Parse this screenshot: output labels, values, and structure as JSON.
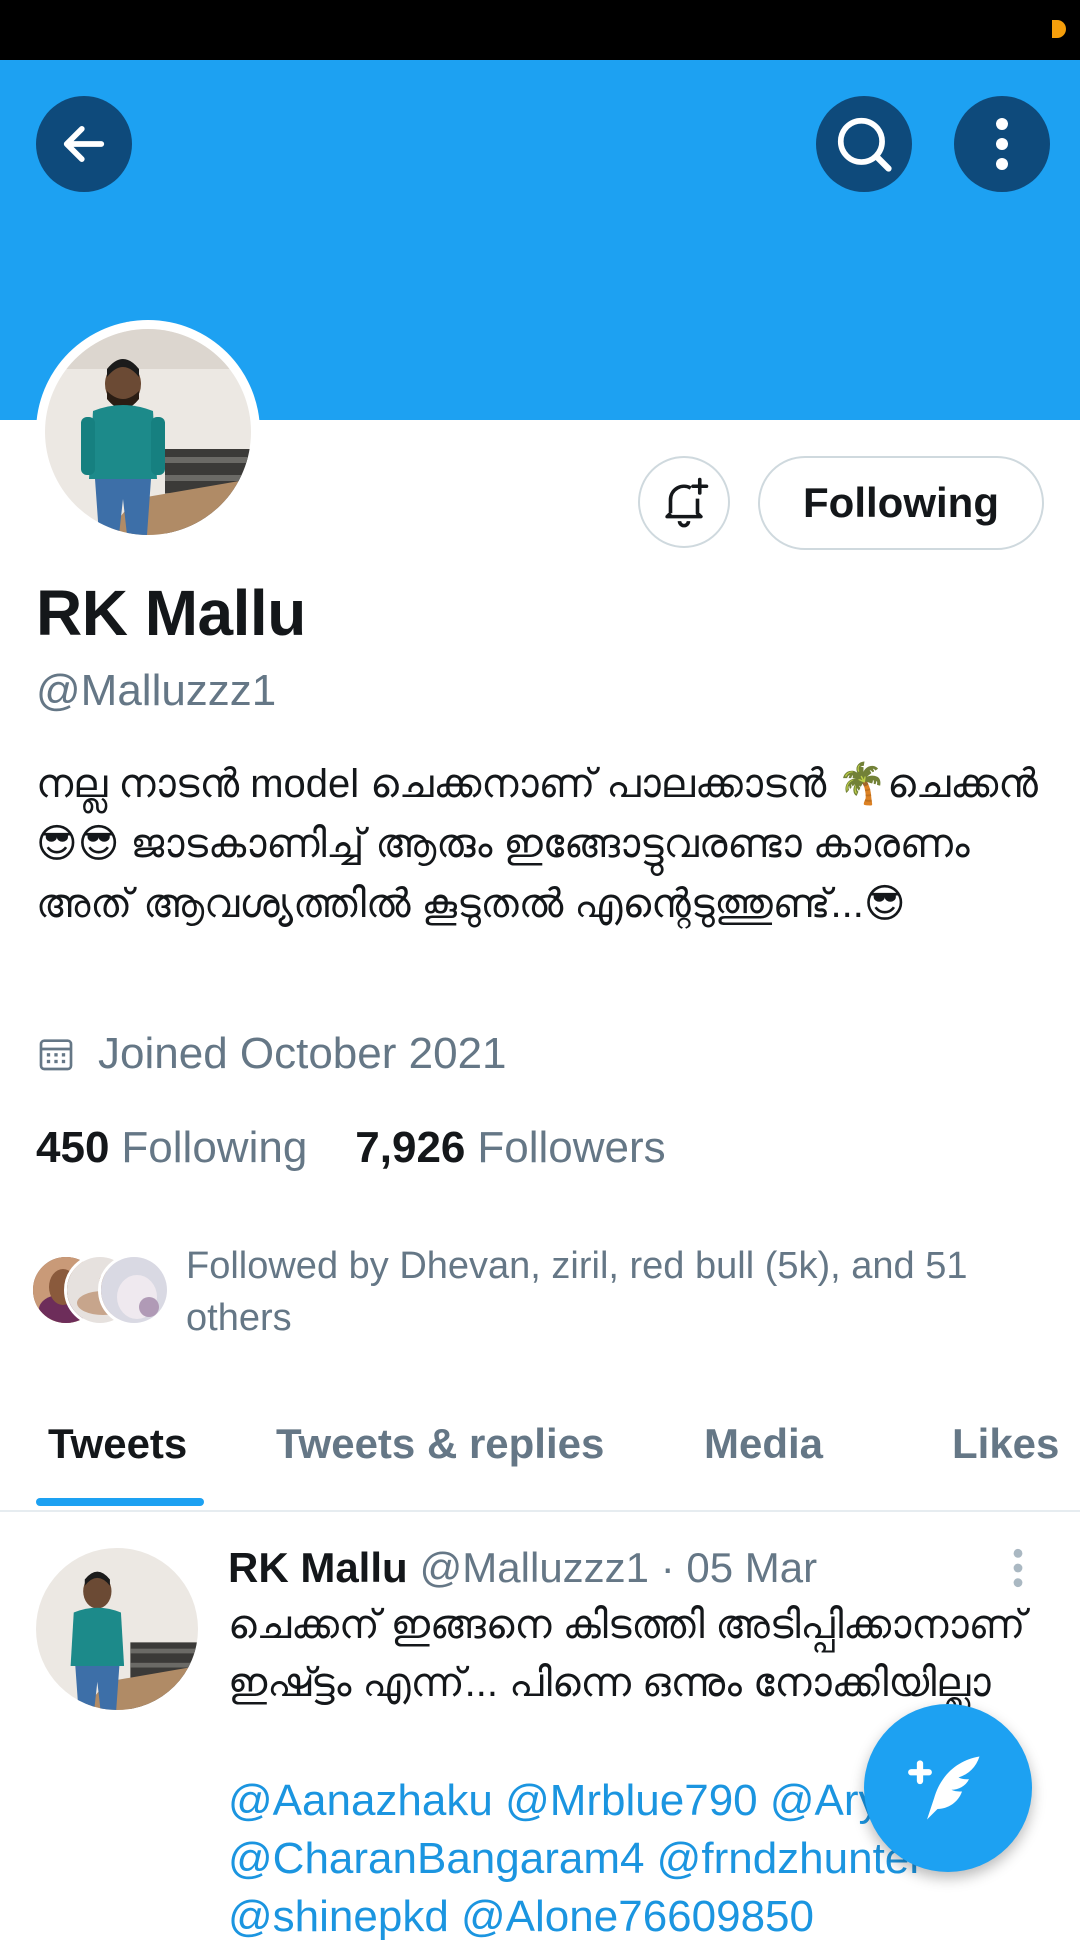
{
  "header": {
    "back_icon": "arrow-left-icon",
    "search_icon": "search-icon",
    "more_icon": "more-vertical-icon",
    "banner_color": "#1da1f2"
  },
  "profile": {
    "display_name": "RK Mallu",
    "handle": "@Malluzzz1",
    "bio": "നല്ല നാടൻ model ചെക്കനാണ് പാലക്കാടൻ 🌴ചെക്കൻ😎😎 ജാടകാണിച്ച് ആരും ഇങ്ങോട്ടുവരണ്ടാ കാരണം അത് ആവശ്യത്തിൽ കൂടുതൽ എന്റെടുത്തുണ്ട്...😎",
    "joined": "Joined October 2021",
    "following_count": "450",
    "following_label": "Following",
    "followers_count": "7,926",
    "followers_label": "Followers",
    "followed_by": "Followed by Dhevan, ziril, red bull (5k), and 51 others"
  },
  "actions": {
    "notify_icon": "bell-plus-icon",
    "follow_state": "Following"
  },
  "tabs": [
    {
      "label": "Tweets",
      "active": true
    },
    {
      "label": "Tweets & replies",
      "active": false
    },
    {
      "label": "Media",
      "active": false
    },
    {
      "label": "Likes",
      "active": false
    }
  ],
  "tweet": {
    "name": "RK Mallu",
    "meta": "@Malluzzz1 · 05 Mar",
    "text": "ചെക്കന് ഇങ്ങനെ കിടത്തി അടിപ്പിക്കാനാണ് ഇഷ്ട്ടം എന്ന്... പിന്നെ ഒന്നും നോക്കിയില്ലാ",
    "mentions": "@Aanazhaku @Mrblue790 @Aryan2022\n@CharanBangaram4 @frndzhunter\n@shinepkd @Alone76609850"
  },
  "fab": {
    "icon": "compose-tweet-icon"
  },
  "colors": {
    "accent": "#1da1f2",
    "link": "#1b95e0",
    "secondary_text": "#657786"
  }
}
